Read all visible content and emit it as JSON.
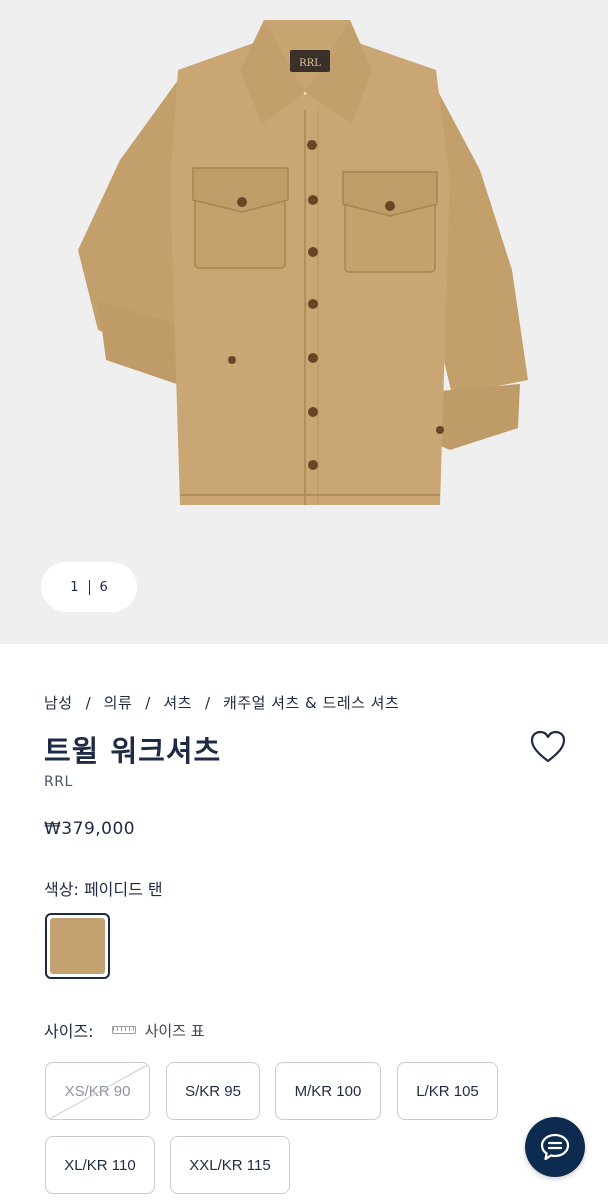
{
  "gallery": {
    "current_page": "1",
    "total_pages": "6",
    "image_alt": "shirt-product-image"
  },
  "breadcrumb": [
    "남성",
    "의류",
    "셔츠",
    "캐주얼 셔츠 & 드레스 셔츠"
  ],
  "breadcrumb_separator": "/",
  "product": {
    "title": "트윌 워크셔츠",
    "brand": "RRL",
    "price": "₩379,000"
  },
  "color": {
    "label": "색상:",
    "selected": "페이디드 탠",
    "swatch_hex": "#c4a170"
  },
  "size": {
    "label": "사이즈:",
    "guide_label": "사이즈 표",
    "options": [
      {
        "label": "XS/KR 90",
        "available": false
      },
      {
        "label": "S/KR 95",
        "available": true
      },
      {
        "label": "M/KR 100",
        "available": true
      },
      {
        "label": "L/KR 105",
        "available": true
      },
      {
        "label": "XL/KR 110",
        "available": true
      },
      {
        "label": "XXL/KR 115",
        "available": true
      }
    ]
  },
  "icons": {
    "wishlist": "heart-icon",
    "chat": "chat-bubble-icon",
    "size_guide": "ruler-icon"
  },
  "colors": {
    "text": "#1f2a44",
    "hero_background": "#f0efef",
    "chat_button": "#0d2b4e",
    "shirt": "#c9a674"
  }
}
